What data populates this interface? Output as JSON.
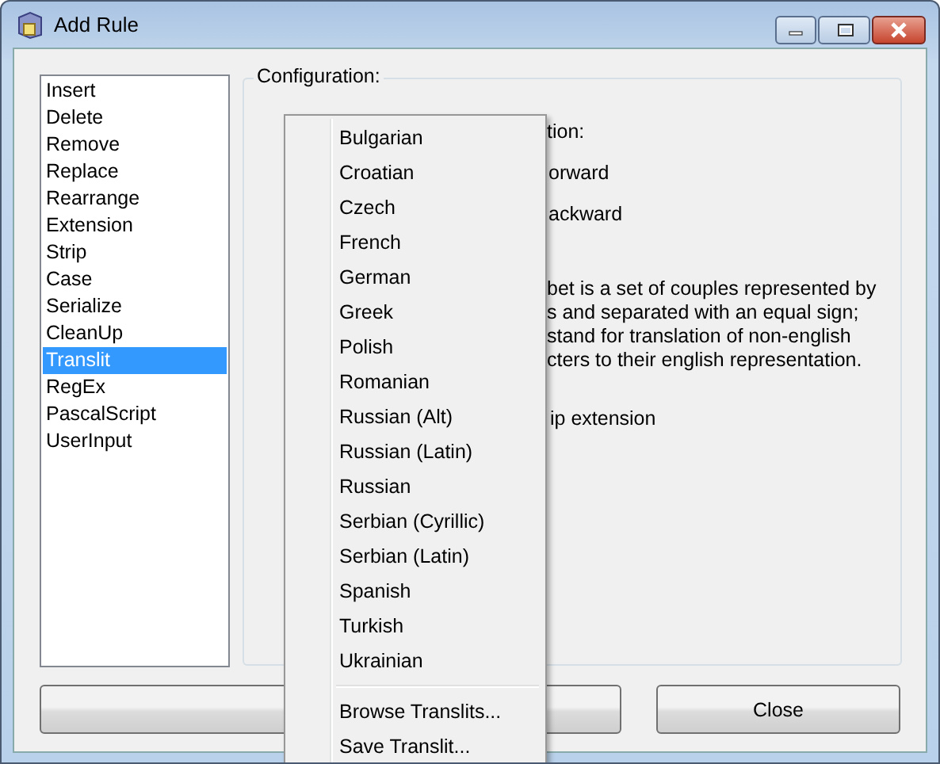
{
  "window": {
    "title": "Add Rule"
  },
  "rule_list": {
    "items": [
      {
        "label": "Insert",
        "selected": false
      },
      {
        "label": "Delete",
        "selected": false
      },
      {
        "label": "Remove",
        "selected": false
      },
      {
        "label": "Replace",
        "selected": false
      },
      {
        "label": "Rearrange",
        "selected": false
      },
      {
        "label": "Extension",
        "selected": false
      },
      {
        "label": "Strip",
        "selected": false
      },
      {
        "label": "Case",
        "selected": false
      },
      {
        "label": "Serialize",
        "selected": false
      },
      {
        "label": "CleanUp",
        "selected": false
      },
      {
        "label": "Translit",
        "selected": true
      },
      {
        "label": "RegEx",
        "selected": false
      },
      {
        "label": "PascalScript",
        "selected": false
      },
      {
        "label": "UserInput",
        "selected": false
      }
    ]
  },
  "configuration": {
    "title": "Configuration:",
    "heading_fragment": "tion:",
    "option_fragments": [
      "orward",
      "ackward"
    ],
    "description_fragments": [
      "bet is a set of couples represented by",
      "s and separated with an equal sign;",
      "stand for translation of non-english",
      "cters to their english representation."
    ],
    "checkbox_fragment": "ip extension"
  },
  "menu": {
    "items": [
      {
        "kind": "item",
        "label": "Bulgarian"
      },
      {
        "kind": "item",
        "label": "Croatian"
      },
      {
        "kind": "item",
        "label": "Czech"
      },
      {
        "kind": "item",
        "label": "French"
      },
      {
        "kind": "item",
        "label": "German"
      },
      {
        "kind": "item",
        "label": "Greek"
      },
      {
        "kind": "item",
        "label": "Polish"
      },
      {
        "kind": "item",
        "label": "Romanian"
      },
      {
        "kind": "item",
        "label": "Russian (Alt)"
      },
      {
        "kind": "item",
        "label": "Russian (Latin)"
      },
      {
        "kind": "item",
        "label": "Russian"
      },
      {
        "kind": "item",
        "label": "Serbian (Cyrillic)"
      },
      {
        "kind": "item",
        "label": "Serbian (Latin)"
      },
      {
        "kind": "item",
        "label": "Spanish"
      },
      {
        "kind": "item",
        "label": "Turkish"
      },
      {
        "kind": "item",
        "label": "Ukrainian"
      },
      {
        "kind": "separator"
      },
      {
        "kind": "item",
        "label": "Browse Translits..."
      },
      {
        "kind": "item",
        "label": "Save Translit..."
      }
    ]
  },
  "buttons": [
    {
      "kind": "covered"
    },
    {
      "kind": "plain",
      "label": "Close"
    }
  ]
}
